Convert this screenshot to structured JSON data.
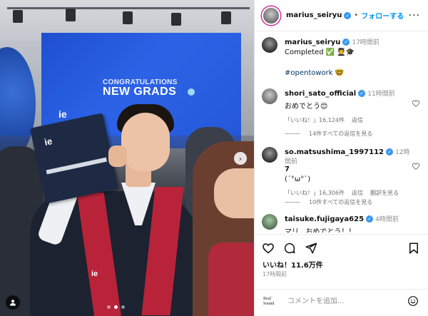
{
  "photo": {
    "screen_line1": "CONGRATULATIONS",
    "screen_line2": "NEW GRADS",
    "screen_logo": "ie",
    "folder_logo": "ie",
    "chest_logo": "ie",
    "carousel": {
      "count": 3,
      "active_index": 1
    }
  },
  "header": {
    "username": "marius_seiryu",
    "separator": "•",
    "follow_label": "フォローする",
    "more_label": "···"
  },
  "caption": {
    "username": "marius_seiryu",
    "time": "17時間前",
    "text": "Completed ✅ 🧑‍🎓🎓",
    "hashtag": "#opentowork 🤓"
  },
  "comments": [
    {
      "username": "shori_sato_official",
      "time": "11時間前",
      "text": "おめでとう😊",
      "likes": "「いいね！」16,124件",
      "reply": "返信",
      "view_replies": "14件すべての返信を見る"
    },
    {
      "username": "so.matsushima_1997112",
      "username_cont": "7",
      "time": "12時間前",
      "text": "(´°ω°`)",
      "likes": "「いいね！」16,306件",
      "reply": "返信",
      "translate": "翻訳を見る",
      "view_replies": "10件すべての返信を見る"
    },
    {
      "username": "taisuke.fujigaya625",
      "time": "4時間前",
      "text": "マリ、おめでとう！！"
    }
  ],
  "actions": {
    "likes": "いいね！11.6万件",
    "time": "17時間前"
  },
  "composer": {
    "source_line1": "Real",
    "source_line2": "Sound",
    "placeholder": "コメントを追加..."
  },
  "colors": {
    "accent": "#0095f6",
    "verified": "#3897f0",
    "stole": "#b8233a",
    "screen": "#2457d8"
  }
}
